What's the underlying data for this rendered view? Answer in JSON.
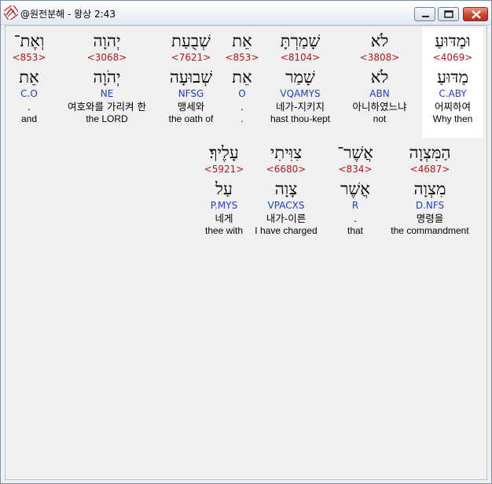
{
  "window": {
    "title": "@원전분해 - 왕상 2:43",
    "controls": [
      "minimize",
      "maximize",
      "close"
    ]
  },
  "rows": [
    {
      "words": [
        {
          "hebrew": "וּמַדּוּעַ",
          "strong": "<4069>",
          "lemma": "מַדּוּעַ",
          "morph": "C.ABY",
          "korean": "어찌하여",
          "english": "Why then",
          "highlighted": true
        },
        {
          "hebrew": "לֹא",
          "strong": "<3808>",
          "lemma": "לֹא",
          "morph": "ABN",
          "korean": "아니하였느냐",
          "english": "not"
        },
        {
          "hebrew": "שָׁמַרְתָּ",
          "strong": "<8104>",
          "lemma": "שָׁמַר",
          "morph": "VQAMYS",
          "korean": "네가-지키지",
          "english": "hast thou-kept"
        },
        {
          "hebrew": "אֵת",
          "strong": "<853>",
          "lemma": "אֵת",
          "morph": "O",
          "korean": ".",
          "english": "."
        },
        {
          "hebrew": "שְׁבֻעַת",
          "strong": "<7621>",
          "lemma": "שְׁבוּעָה",
          "morph": "NFSG",
          "korean": "맹세와",
          "english": "the oath of"
        },
        {
          "hebrew": "יְהוָה",
          "strong": "<3068>",
          "lemma": "יְהֹוָה",
          "morph": "NE",
          "korean": "여호와를 가리켜 한",
          "english": "the LORD"
        },
        {
          "hebrew": "וְאֶת־",
          "strong": "<853>",
          "lemma": "אֵת",
          "morph": "C.O",
          "korean": ".",
          "english": "and"
        }
      ]
    },
    {
      "words": [
        {
          "hebrew": "הַמִּצְוָה",
          "strong": "<4687>",
          "lemma": "מִצְוָה",
          "morph": "D.NFS",
          "korean": "명령을",
          "english": "the commandment"
        },
        {
          "hebrew": "אֲשֶׁר־",
          "strong": "<834>",
          "lemma": "אֲשֶׁר",
          "morph": "R",
          "korean": ".",
          "english": "that"
        },
        {
          "hebrew": "צִוִּיתִי",
          "strong": "<6680>",
          "lemma": "צָוָה",
          "morph": "VPACXS",
          "korean": "내가-이른",
          "english": "I have charged"
        },
        {
          "hebrew": "עָלֶיךָ׃",
          "strong": "<5921>",
          "lemma": "עַל",
          "morph": "P.MYS",
          "korean": "네게",
          "english": "thee with"
        }
      ]
    }
  ]
}
